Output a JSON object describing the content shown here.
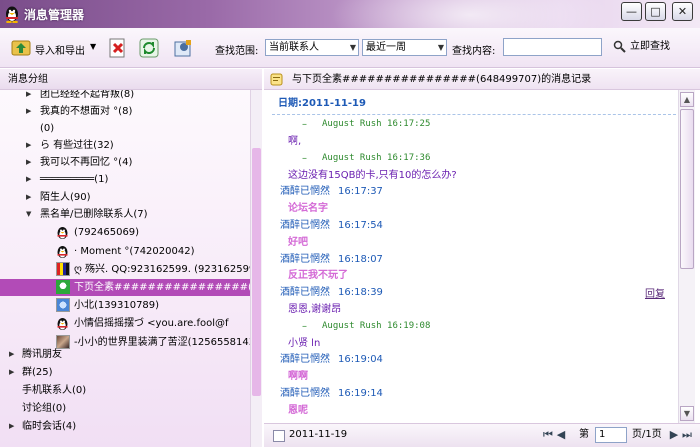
{
  "window": {
    "title": "消息管理器",
    "buttons": {
      "minimize": "—",
      "maximize": "□",
      "close": "✕"
    }
  },
  "toolbar": {
    "import_export": "导入和导出",
    "search_range_label": "查找范围:",
    "contact_scope": "当前联系人",
    "time_range": "最近一周",
    "search_content_label": "查找内容:",
    "search_value": "",
    "search_button": "立即查找"
  },
  "left": {
    "header": "消息分组",
    "rows": [
      {
        "exp": "▶",
        "text": "团已经经不起背叛(8)",
        "level": 1
      },
      {
        "exp": "▶",
        "text": "我真的不想面对 °(8)",
        "level": 1
      },
      {
        "exp": "",
        "text": "(0)",
        "level": 1
      },
      {
        "exp": "▶",
        "text": "ら          有些过往(32)",
        "level": 1
      },
      {
        "exp": "▶",
        "text": "我可以不再回忆 °(4)",
        "level": 1
      },
      {
        "exp": "▶",
        "text": "═════════(1)",
        "level": 1
      },
      {
        "exp": "▶",
        "text": "陌生人(90)",
        "level": 1
      },
      {
        "exp": "▼",
        "text": "黑名单/已删除联系人(7)",
        "level": 1
      },
      {
        "exp": "",
        "text": "(792465069)",
        "level": 2,
        "icon": "penguin-icon"
      },
      {
        "exp": "",
        "text": "·  Moment °(742020042)",
        "level": 2,
        "icon": "penguin-icon"
      },
      {
        "exp": "",
        "text": "ღ     殇兴. QQ:923162599. (923162599)",
        "level": 2,
        "icon": "avatar"
      },
      {
        "exp": "",
        "text": "下页全素################(648",
        "level": 2,
        "icon": "avatar-green",
        "selected": true
      },
      {
        "exp": "",
        "text": "小北(139310789)",
        "level": 2,
        "icon": "avatar-blue"
      },
      {
        "exp": "",
        "text": "小情侣摇摇摆づ     <you.are.fool@f",
        "level": 2,
        "icon": "penguin-icon"
      },
      {
        "exp": "",
        "text": "-小小的世界里装满了苦涩(1256558143",
        "level": 2,
        "icon": "avatar-photo"
      },
      {
        "exp": "▶",
        "text": "腾讯朋友",
        "level": 0
      },
      {
        "exp": "▶",
        "text": "群(25)",
        "level": 0
      },
      {
        "exp": "",
        "text": "手机联系人(0)",
        "level": 0
      },
      {
        "exp": "",
        "text": "讨论组(0)",
        "level": 0
      },
      {
        "exp": "▶",
        "text": "临时会话(4)",
        "level": 0
      }
    ]
  },
  "right": {
    "header": "与下页全素################(648499707)的消息记录",
    "date_label": "日期:2011-11-19",
    "messages": [
      {
        "kind": "meta",
        "sender": "–",
        "time": "August Rush 16:17:25",
        "sender_color": "#2e8a2e"
      },
      {
        "kind": "content",
        "text": "啊,",
        "color": "#6a1fb0"
      },
      {
        "kind": "meta",
        "sender": "–",
        "time": "August Rush 16:17:36",
        "sender_color": "#2e8a2e"
      },
      {
        "kind": "content",
        "text": "这边没有15QB的卡,只有10的怎么办?",
        "color": "#6a1fb0"
      },
      {
        "kind": "meta",
        "sender": "酒醉已惘然",
        "time": "16:17:37",
        "sender_color": "#1e5ab6"
      },
      {
        "kind": "content",
        "text": "论坛名字",
        "color": "#d46ad6"
      },
      {
        "kind": "meta",
        "sender": "酒醉已惘然",
        "time": "16:17:54",
        "sender_color": "#1e5ab6"
      },
      {
        "kind": "content",
        "text": "好吧",
        "color": "#d46ad6"
      },
      {
        "kind": "meta",
        "sender": "酒醉已惘然",
        "time": "16:18:07",
        "sender_color": "#1e5ab6"
      },
      {
        "kind": "content",
        "text": "反正我不玩了",
        "color": "#d46ad6"
      },
      {
        "kind": "meta",
        "sender": "酒醉已惘然",
        "time": "16:18:39",
        "sender_color": "#1e5ab6"
      },
      {
        "kind": "content",
        "text": "恩恩,谢谢昂",
        "color": "#6a1fb0"
      },
      {
        "kind": "meta",
        "sender": "–",
        "time": "August Rush 16:19:08",
        "sender_color": "#2e8a2e"
      },
      {
        "kind": "content",
        "text": "小贤        ln",
        "color": "#6a1fb0"
      },
      {
        "kind": "meta",
        "sender": "酒醉已惘然",
        "time": "16:19:04",
        "sender_color": "#1e5ab6"
      },
      {
        "kind": "content",
        "text": "啊啊",
        "color": "#d46ad6"
      },
      {
        "kind": "meta",
        "sender": "酒醉已惘然",
        "time": "16:19:14",
        "sender_color": "#1e5ab6"
      },
      {
        "kind": "content",
        "text": "恩呢",
        "color": "#d46ad6"
      }
    ],
    "reply_link": "回复"
  },
  "footer": {
    "date": "2011-11-19",
    "page_label": "第",
    "page_value": "1",
    "page_total": "页/1页"
  }
}
